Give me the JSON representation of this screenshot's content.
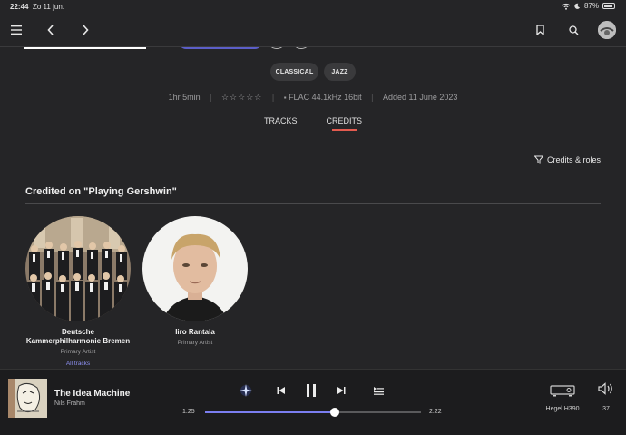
{
  "status_bar": {
    "time": "22:44",
    "date": "Zo 11 jun.",
    "battery": "87%"
  },
  "tags": [
    "CLASSICAL",
    "JAZZ"
  ],
  "meta": {
    "duration": "1hr 5min",
    "format": "FLAC 44.1kHz 16bit",
    "added": "Added 11 June 2023"
  },
  "tabs": {
    "tracks": "TRACKS",
    "credits": "CREDITS"
  },
  "credits_roles": "Credits & roles",
  "section_title": "Credited on \"Playing Gershwin\"",
  "artists": [
    {
      "name_line1": "Deutsche",
      "name_line2": "Kammerphilharmonie Bremen",
      "role": "Primary Artist",
      "link": "All tracks"
    },
    {
      "name_line1": "Iiro Rantala",
      "role": "Primary Artist"
    }
  ],
  "player": {
    "title": "The Idea Machine",
    "artist": "Nils Frahm",
    "elapsed": "1:25",
    "total": "2:22",
    "progress": 0.6,
    "device": "Hegel H390",
    "volume": "37"
  },
  "colors": {
    "accent": "#7b7ef0",
    "active_tab": "#e35b4f",
    "background": "#252527"
  }
}
